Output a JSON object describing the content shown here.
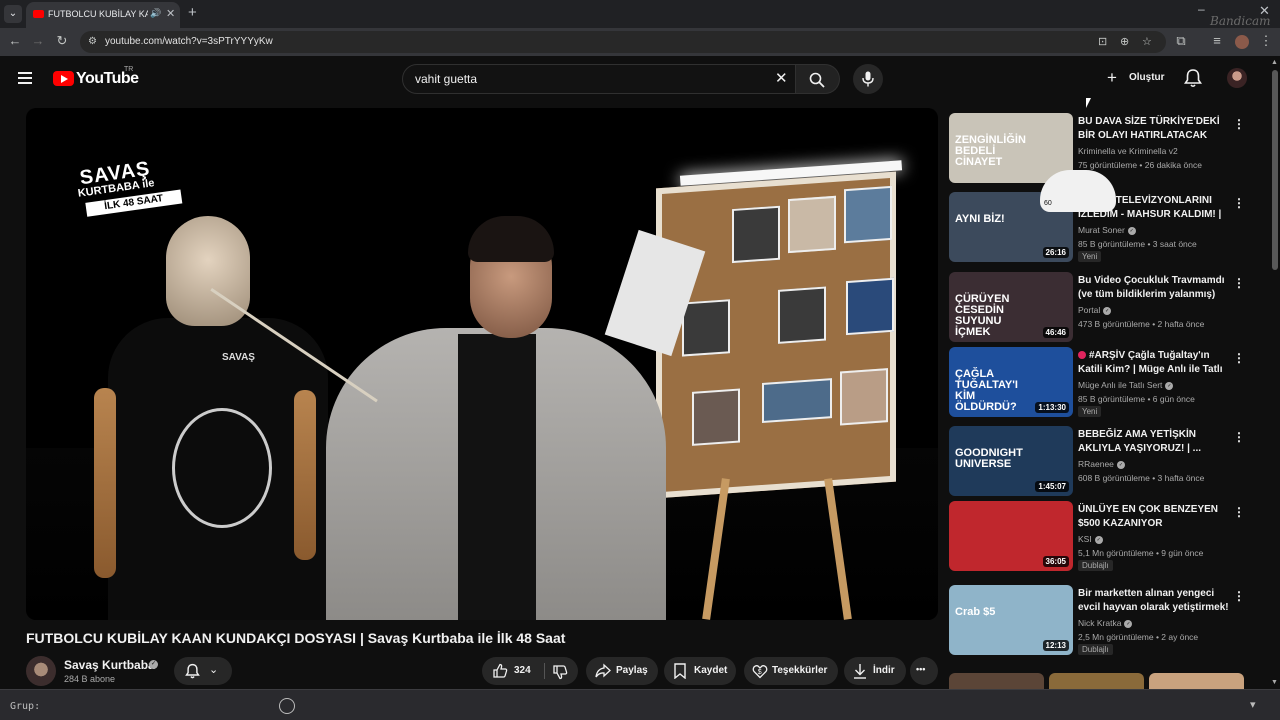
{
  "browser": {
    "tab_title": "FUTBOLCU KUBİLAY KAAN",
    "tab_dropdown_glyph": "⌄",
    "audio_glyph": "🔊",
    "close_glyph": "✕",
    "new_tab_glyph": "+",
    "minimize_glyph": "–",
    "window_close_glyph": "✕",
    "watermark": "Bandicam",
    "url": "youtube.com/watch?v=3sPTrYYYyKw",
    "back_glyph": "←",
    "forward_glyph": "→",
    "reload_glyph": "↻",
    "menu_glyph": "⋮"
  },
  "header": {
    "logo_text": "YouTube",
    "country_code": "TR",
    "search_value": "vahit guetta",
    "clear_glyph": "✕",
    "create_label": "Oluştur",
    "create_glyph": "+"
  },
  "player": {
    "show_logo_line1": "SAVAŞ",
    "show_logo_line2": "KURTBABA ile",
    "show_logo_line3": "İLK 48 SAAT",
    "shirt_text": "SAVAŞ"
  },
  "video": {
    "title": "FUTBOLCU KUBİLAY KAAN KUNDAKÇI DOSYASI | Savaş Kurtbaba ile İlk 48 Saat",
    "channel": "Savaş Kurtbaba",
    "subscribers": "284 B abone",
    "likes": "324",
    "share_label": "Paylaş",
    "save_label": "Kaydet",
    "thanks_label": "Teşekkürler",
    "download_label": "İndir",
    "more_glyph": "•••"
  },
  "recommendations": [
    {
      "title": "BU DAVA SİZE TÜRKİYE'DEKİ BİR OLAYI HATIRLATACAK",
      "channel": "Kriminella ve Kriminella v2",
      "meta": "75 görüntüleme • 26 dakika önce",
      "duration": "",
      "badge": "",
      "verified": false,
      "thumb_text": "ZENGİNLİĞİN BEDELİ CİNAYET",
      "thumb_color": "#c9c4b8"
    },
    {
      "title": "BÜTÜN TELEVİZYONLARINI İZLEDİM - MAHSUR KALDIM! | ...",
      "channel": "Murat Soner",
      "meta": "85 B görüntüleme • 3 saat önce",
      "duration": "26:16",
      "badge": "Yeni",
      "verified": true,
      "thumb_text": "AYNI BİZ!",
      "thumb_color": "#3c4a5c"
    },
    {
      "title": "Bu Video Çocukluk Travmamdı (ve tüm bildiklerim yalanmış)",
      "channel": "Portal",
      "meta": "473 B görüntüleme • 2 hafta önce",
      "duration": "46:46",
      "badge": "",
      "verified": true,
      "thumb_text": "ÇÜRÜYEN CESEDİN SUYUNU İÇMEK",
      "thumb_color": "#3b2d33"
    },
    {
      "title": "#ARŞİV Çağla Tuğaltay'ın Katili Kim? | Müge Anlı ile Tatlı ...",
      "channel": "Müge Anlı ile Tatlı Sert",
      "meta": "85 B görüntüleme • 6 gün önce",
      "duration": "1:13:30",
      "badge": "Yeni",
      "verified": true,
      "thumb_text": "ÇAĞLA TUĞALTAY'I KİM ÖLDÜRDÜ?",
      "thumb_color": "#1e4f9c"
    },
    {
      "title": "BEBEĞİZ AMA YETİŞKİN AKLIYLA YAŞIYORUZ! | ...",
      "channel": "RRaenee",
      "meta": "608 B görüntüleme • 3 hafta önce",
      "duration": "1:45:07",
      "badge": "",
      "verified": true,
      "thumb_text": "GOODNIGHT UNIVERSE",
      "thumb_color": "#1f3a5a"
    },
    {
      "title": "ÜNLÜYE EN ÇOK BENZEYEN $500 KAZANIYOR",
      "channel": "KSI",
      "meta": "5,1 Mn görüntüleme • 9 gün önce",
      "duration": "36:05",
      "badge": "Dublajlı",
      "verified": true,
      "thumb_text": "",
      "thumb_color": "#c0272d"
    },
    {
      "title": "Bir marketten alınan yengeci evcil hayvan olarak yetiştirmek!",
      "channel": "Nick Kratka",
      "meta": "2,5 Mn görüntüleme • 2 ay önce",
      "duration": "12:13",
      "badge": "Dublajlı",
      "verified": true,
      "thumb_text": "Crab $5",
      "thumb_color": "#8fb4c9"
    }
  ],
  "sticker": {
    "label": "60"
  },
  "group_bar": {
    "label": "Grup:",
    "chevron": "▾"
  },
  "colors": {
    "brand_red": "#ff0000",
    "background": "#0f0f0f",
    "button_bg": "#272727"
  }
}
